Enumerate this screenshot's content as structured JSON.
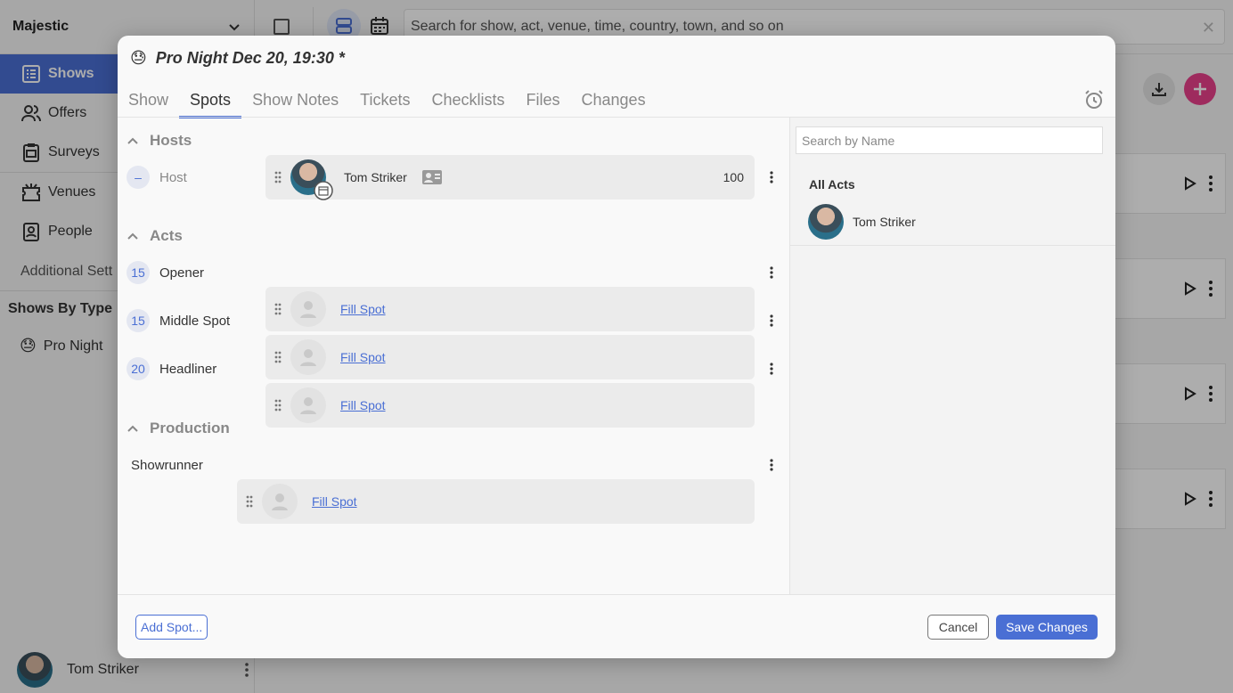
{
  "sidebar": {
    "venue": "Majestic",
    "nav": [
      {
        "label": "Shows",
        "icon": "list-icon",
        "active": true
      },
      {
        "label": "Offers",
        "icon": "people-icon"
      },
      {
        "label": "Surveys",
        "icon": "clipboard-icon"
      },
      {
        "label": "Venues",
        "icon": "venue-icon"
      },
      {
        "label": "People",
        "icon": "badge-icon"
      }
    ],
    "additional": "Additional Sett",
    "shows_by_type_heading": "Shows By Type",
    "show_types": [
      {
        "emoji": "😓",
        "label": "Pro Night"
      }
    ],
    "user_name": "Tom Striker"
  },
  "topbar": {
    "search_placeholder": "Search for show, act, venue, time, country, town, and so on",
    "clear": "✕"
  },
  "modal": {
    "emoji": "😓",
    "title": "Pro Night Dec 20, 19:30 *",
    "tabs": [
      "Show",
      "Spots",
      "Show Notes",
      "Tickets",
      "Checklists",
      "Files",
      "Changes"
    ],
    "active_tab": "Spots",
    "sections": {
      "hosts": "Hosts",
      "acts": "Acts",
      "production": "Production"
    },
    "host": {
      "num": "–",
      "label": "Host",
      "name": "Tom Striker",
      "minutes": "100"
    },
    "acts": [
      {
        "num": "15",
        "label": "Opener",
        "fill": "Fill Spot"
      },
      {
        "num": "15",
        "label": "Middle Spot",
        "fill": "Fill Spot"
      },
      {
        "num": "20",
        "label": "Headliner",
        "fill": "Fill Spot"
      }
    ],
    "production": {
      "label": "Showrunner",
      "fill": "Fill Spot"
    },
    "right": {
      "search_placeholder": "Search by Name",
      "all_acts": "All Acts",
      "act_name": "Tom Striker"
    },
    "footer": {
      "add_spot": "Add Spot...",
      "cancel": "Cancel",
      "save": "Save Changes"
    }
  },
  "colors": {
    "accent": "#4a6fd4",
    "fab": "#e9408b"
  }
}
